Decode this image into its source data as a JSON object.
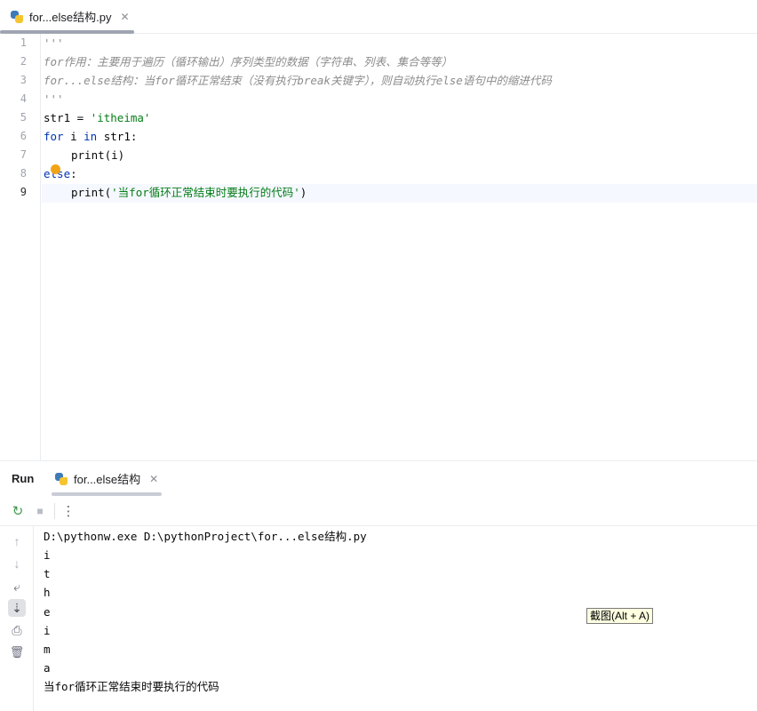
{
  "editor_tab": {
    "label": "for...else结构.py",
    "close": "✕"
  },
  "code": {
    "line_numbers": [
      "1",
      "2",
      "3",
      "4",
      "5",
      "6",
      "7",
      "8",
      "9"
    ],
    "docstring_open": "'''",
    "comment_line_2": "for作用：主要用于遍历（循环输出）序列类型的数据（字符串、列表、集合等等）",
    "comment_line_3": "for...else结构：当for循环正常结束（没有执行break关键字），则自动执行else语句中的缩进代码",
    "docstring_close": "'''",
    "line5_var": "str1 = ",
    "line5_str": "'itheima'",
    "line6_for": "for",
    "line6_mid": " i ",
    "line6_in": "in",
    "line6_rest": " str1:",
    "line7_call": "print(i)",
    "line8_else": "else",
    "line8_colon": ":",
    "line9_fn": "print(",
    "line9_str": "'当for循环正常结束时要执行的代码'",
    "line9_close": ")"
  },
  "run_panel": {
    "title": "Run",
    "tab_label": "for...else结构",
    "tab_close": "✕"
  },
  "toolbar": {
    "rerun_icon": "↻",
    "stop_icon": "■",
    "more_icon": "⋮"
  },
  "side_icons": {
    "up": "↑",
    "down": "↓",
    "wrap": "⤶",
    "scroll_end": "⇣",
    "print": "⎙",
    "trash": "🗑"
  },
  "console": {
    "lines": [
      "D:\\pythonw.exe D:\\pythonProject\\for...else结构.py",
      "i",
      "t",
      "h",
      "e",
      "i",
      "m",
      "a",
      "当for循环正常结束时要执行的代码"
    ]
  },
  "tooltip": {
    "text": "截图(Alt + A)"
  }
}
